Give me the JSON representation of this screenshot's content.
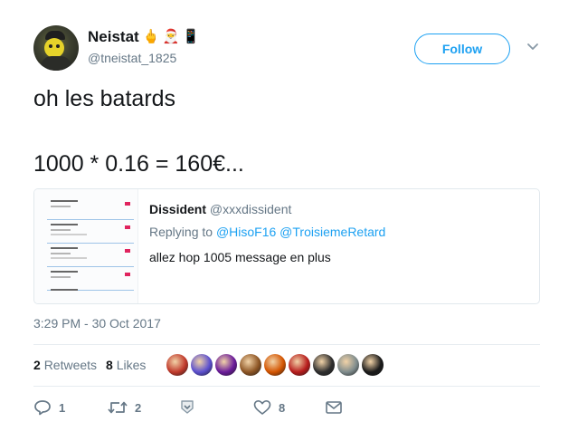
{
  "author": {
    "display_name": "Neistat",
    "emojis": [
      "🖕",
      "🎅",
      "📱"
    ],
    "handle": "@tneistat_1825"
  },
  "follow_label": "Follow",
  "tweet": {
    "line1": "oh les batards",
    "line2": "1000 * 0.16 = 160€..."
  },
  "quote": {
    "name": "Dissident",
    "handle": "@xxxdissident",
    "replying_prefix": "Replying to",
    "mention1": "@HisoF16",
    "mention2": "@TroisiemeRetard",
    "text": "allez hop 1005 message en plus"
  },
  "timestamp": "3:29 PM - 30 Oct 2017",
  "stats": {
    "retweets_count": "2",
    "retweets_label": "Retweets",
    "likes_count": "8",
    "likes_label": "Likes"
  },
  "liker_colors": [
    "#c0392b",
    "#5b4fcf",
    "#6a1b9a",
    "#8d5524",
    "#d35400",
    "#b71c1c",
    "#2e2e2e",
    "#7f8c8d",
    "#1a1a1a"
  ],
  "actions": {
    "reply_count": "1",
    "retweet_count": "2",
    "like_count": "8"
  },
  "colors": {
    "accent": "#1da1f2",
    "secondary_text": "#657786",
    "text": "#14171a",
    "border": "#e1e8ed"
  }
}
